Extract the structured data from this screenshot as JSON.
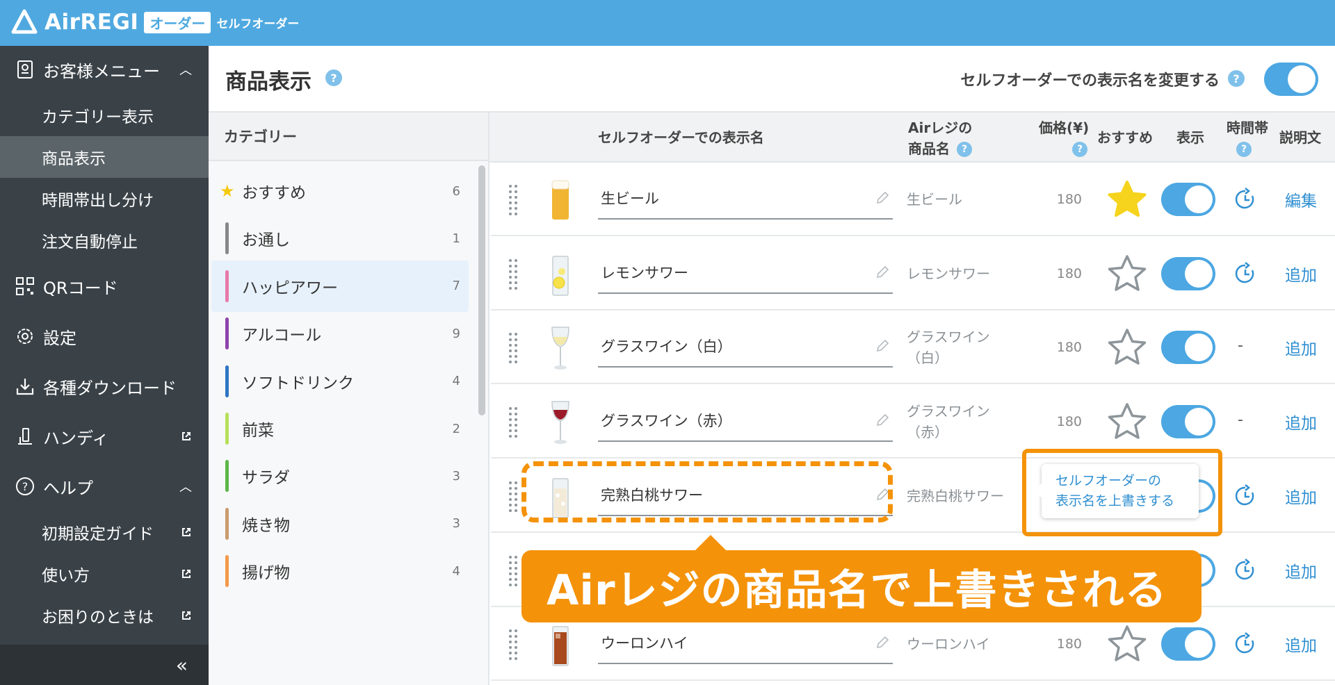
{
  "app": {
    "brand": "AirREGI",
    "badge": "オーダー",
    "subtitle": "セルフオーダー"
  },
  "sidebar": {
    "menu_label": "お客様メニュー",
    "sub_items": [
      "カテゴリー表示",
      "商品表示",
      "時間帯出し分け",
      "注文自動停止"
    ],
    "active_sub": "商品表示",
    "qr_label": "QRコード",
    "settings_label": "設定",
    "download_label": "各種ダウンロード",
    "handy_label": "ハンディ",
    "help_label": "ヘルプ",
    "help_items": [
      "初期設定ガイド",
      "使い方",
      "お困りのときは"
    ],
    "collapse_label": "«"
  },
  "header": {
    "title": "商品表示",
    "help": "?",
    "rename_label": "セルフオーダーでの表示名を変更する",
    "rename_enabled": true
  },
  "categories": {
    "header": "カテゴリー",
    "items": [
      {
        "label": "おすすめ",
        "count": "6",
        "color": "#f6c90e",
        "star": true
      },
      {
        "label": "お通し",
        "count": "1",
        "color": "#888888"
      },
      {
        "label": "ハッピアワー",
        "count": "7",
        "color": "#e879a8",
        "active": true
      },
      {
        "label": "アルコール",
        "count": "9",
        "color": "#8e44ad"
      },
      {
        "label": "ソフトドリンク",
        "count": "4",
        "color": "#2f75c2"
      },
      {
        "label": "前菜",
        "count": "2",
        "color": "#b6e05a"
      },
      {
        "label": "サラダ",
        "count": "3",
        "color": "#5cb648"
      },
      {
        "label": "焼き物",
        "count": "3",
        "color": "#c99b6e"
      },
      {
        "label": "揚げ物",
        "count": "4",
        "color": "#f39a4a"
      }
    ]
  },
  "table": {
    "headers": {
      "display_name": "セルフオーダーでの表示名",
      "air_name_1": "Airレジの",
      "air_name_2": "商品名",
      "price": "価格(¥)",
      "recommend": "おすすめ",
      "visible": "表示",
      "time_slot": "時間帯",
      "description": "説明文",
      "help": "?"
    },
    "rows": [
      {
        "display_name": "生ビール",
        "air_name": "生ビール",
        "price": "180",
        "recommended": true,
        "visible": true,
        "time": "clock",
        "desc": "編集",
        "drink": "beer"
      },
      {
        "display_name": "レモンサワー",
        "air_name": "レモンサワー",
        "price": "180",
        "recommended": false,
        "visible": true,
        "time": "clock",
        "desc": "追加",
        "drink": "lemon"
      },
      {
        "display_name": "グラスワイン（白）",
        "air_name": "グラスワイン（白）",
        "price": "180",
        "recommended": false,
        "visible": true,
        "time": "-",
        "desc": "追加",
        "drink": "white-wine"
      },
      {
        "display_name": "グラスワイン（赤）",
        "air_name": "グラスワイン（赤）",
        "price": "180",
        "recommended": false,
        "visible": true,
        "time": "-",
        "desc": "追加",
        "drink": "red-wine"
      },
      {
        "display_name": "完熟白桃サワー",
        "air_name": "完熟白桃サワー",
        "price": "",
        "recommended": false,
        "visible": true,
        "time": "clock",
        "desc": "追加",
        "drink": "peach"
      },
      {
        "display_name": "",
        "air_name": "",
        "price": "",
        "recommended": false,
        "visible": true,
        "time": "clock",
        "desc": "追加",
        "drink": "none"
      },
      {
        "display_name": "ウーロンハイ",
        "air_name": "ウーロンハイ",
        "price": "180",
        "recommended": false,
        "visible": true,
        "time": "clock",
        "desc": "追加",
        "drink": "oolong"
      }
    ]
  },
  "tooltip": {
    "line1": "セルフオーダーの",
    "line2": "表示名を上書きする"
  },
  "banner": {
    "text": "Airレジの商品名で上書きされる"
  },
  "colors": {
    "primary": "#4fa9e0",
    "toggle": "#4ca7e2",
    "accent_orange": "#f49209",
    "link": "#2f8fd1",
    "star": "#f6c90e"
  }
}
